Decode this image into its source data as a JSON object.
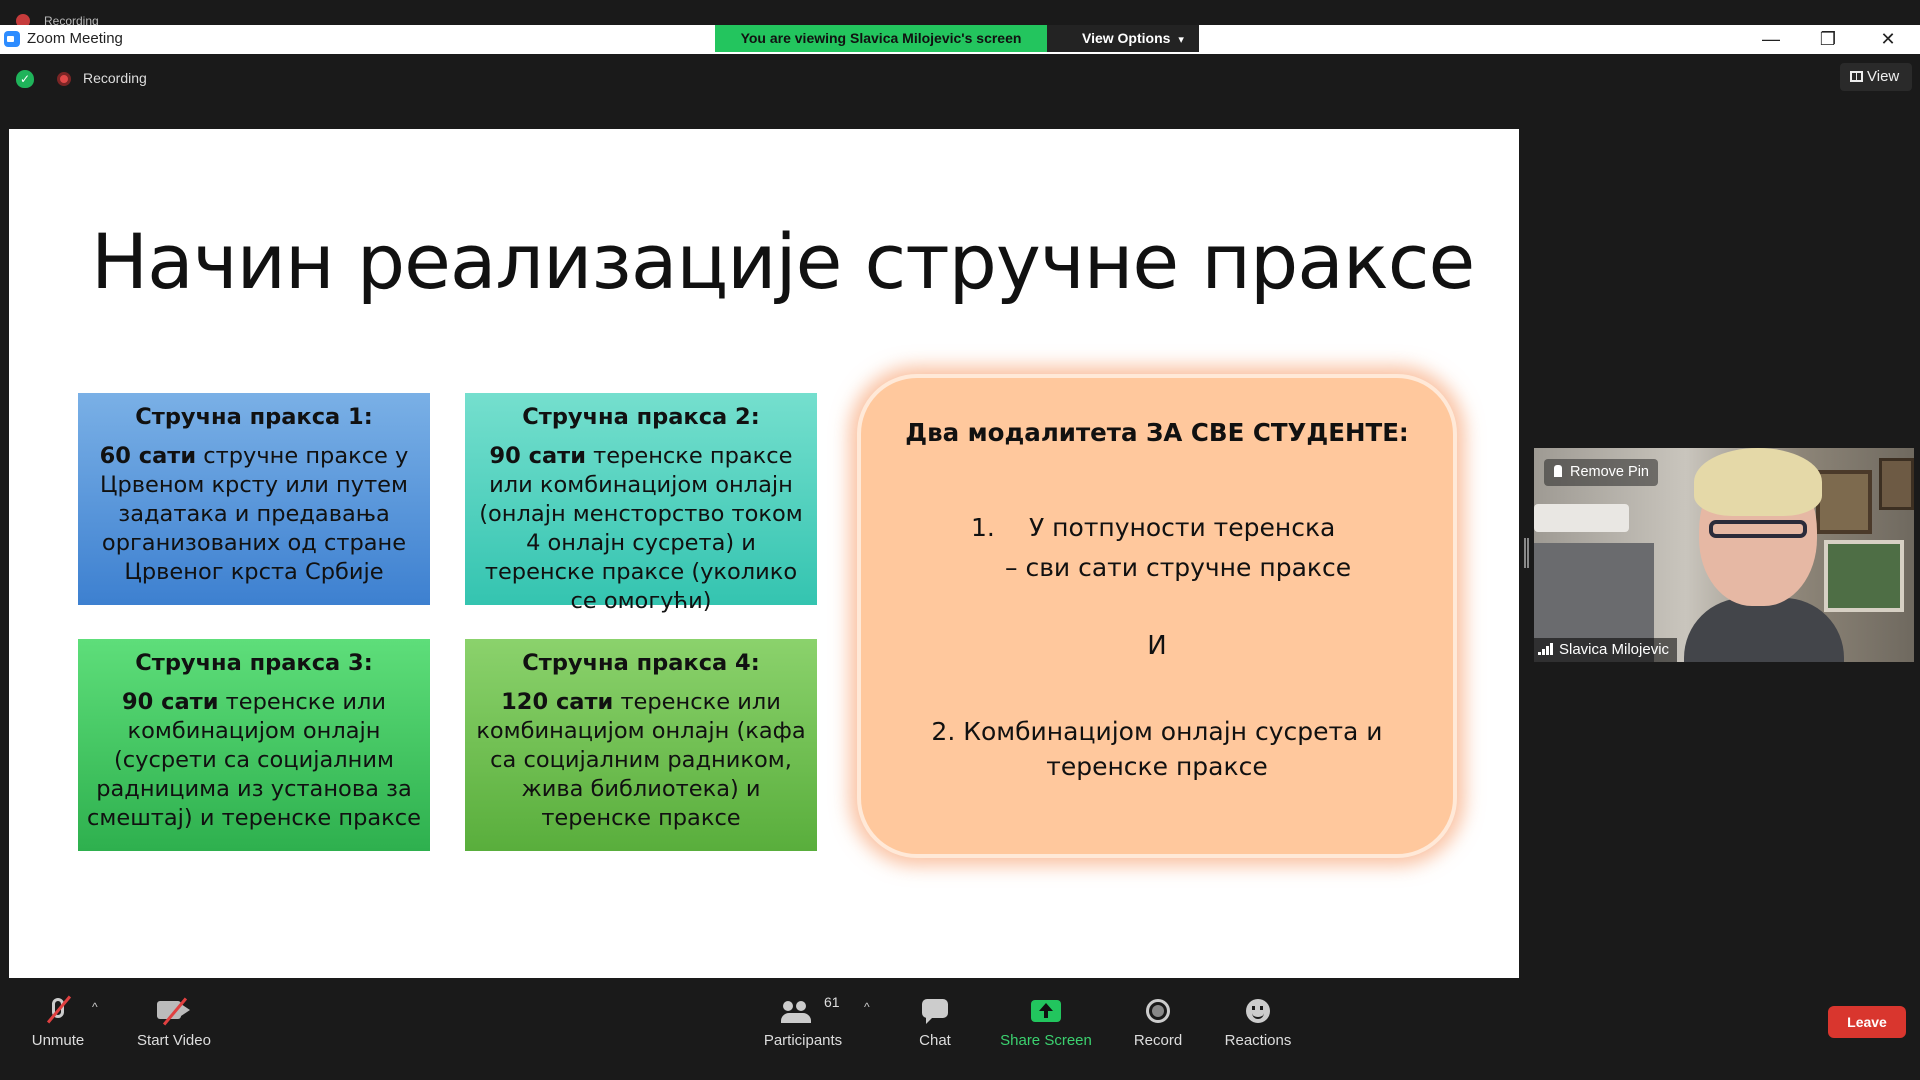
{
  "window": {
    "top_label": "Recording",
    "app_title": "Zoom Meeting",
    "viewing_banner": "You are viewing Slavica Milojevic's screen",
    "view_options_label": "View Options",
    "minimize": "—",
    "restore": "❐",
    "close": "✕"
  },
  "header": {
    "recording_label": "Recording",
    "view_label": "View",
    "shield_glyph": "✓"
  },
  "slide": {
    "title": "Начин реализације стручне праксе",
    "boxes": [
      {
        "heading": "Стручна пракса 1:",
        "bold": "60 сати",
        "text": " стручне праксе у Црвеном крсту или путем задатака и предавања организованих од стране Црвеног крста Србије"
      },
      {
        "heading": "Стручна пракса 2:",
        "bold": "90 сати",
        "text": " теренске праксе или комбинацијом онлајн (онлајн менсторство током 4 онлајн сусрета) и теренске праксе (уколико се омогући)"
      },
      {
        "heading": "Стручна пракса 3:",
        "bold": "90 сати",
        "text": " теренске или комбинацијом онлајн (сусрети са социјалним радницима из установа за смештај) и теренске праксе"
      },
      {
        "heading": "Стручна пракса 4:",
        "bold": "120 сати",
        "text": " теренске или комбинацијом онлајн (кафа са социјалним радником, жива библиотека) и теренске праксе"
      }
    ],
    "modalities": {
      "heading": "Два модалитета ЗА СВЕ СТУДЕНТЕ:",
      "item1_number": "1.",
      "item1_line1": "У потпуности теренска",
      "item1_line2": "– сви сати стручне праксе",
      "conjunction": "И",
      "item2_line1": "2. Комбинацијом онлајн сусрета и",
      "item2_line2": "теренске праксе"
    }
  },
  "video_tile": {
    "remove_pin_label": "Remove Pin",
    "participant_name": "Slavica Milojevic"
  },
  "toolbar": {
    "unmute": "Unmute",
    "start_video": "Start Video",
    "participants": "Participants",
    "participant_count": "61",
    "chat": "Chat",
    "share_screen": "Share Screen",
    "record": "Record",
    "reactions": "Reactions",
    "leave": "Leave",
    "caret": "^"
  },
  "colors": {
    "banner_green": "#23c55e",
    "leave_red": "#d9362e",
    "box1": "#5a98dc",
    "box2": "#55d2c0",
    "box3": "#46c864",
    "box4": "#72c054",
    "modal_fill": "#ffc89d"
  }
}
